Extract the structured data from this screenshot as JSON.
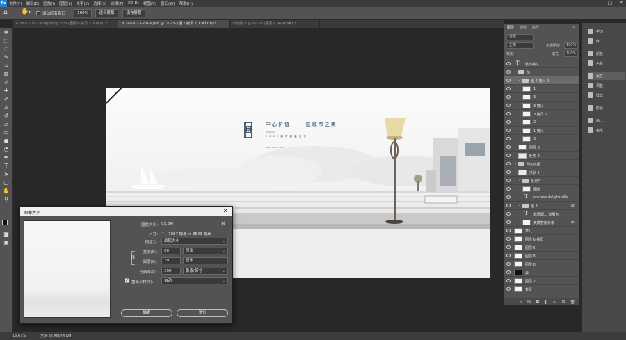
{
  "menubar": {
    "logo": "Ps",
    "items": [
      "文件(F)",
      "编辑(E)",
      "图像(I)",
      "图层(L)",
      "文字(Y)",
      "选择(S)",
      "滤镜(T)",
      "3D(D)",
      "视图(V)",
      "窗口(W)",
      "帮助(H)"
    ],
    "window_buttons": [
      "—",
      "□",
      "✕"
    ]
  },
  "options": {
    "scroll_all_label": "滚动所有窗口",
    "zoom_value": "100%",
    "fit_screen_label": "适合屏幕",
    "fill_screen_label": "填充屏幕"
  },
  "tabs": [
    {
      "label": "2018-12-25-1-h-w.psd @ 25% (图层 6 拷贝, CMYK/8) *",
      "active": false
    },
    {
      "label": "2020-07-27-2-h-w.psd @ 16.7% (组 2 拷贝 2, CMYK/8) *",
      "active": true
    },
    {
      "label": "未标题-1 @ 66.7% (图层 1, RGB/8#) *",
      "active": false
    }
  ],
  "canvas": {
    "headline": "中心价值 · 一揽城市之美",
    "subline": "2 0 1 9 城 市 新 量 力 作",
    "small_caption": "Since Mome Glas",
    "logo_char": "卧"
  },
  "right_strip": {
    "items": [
      "学习",
      "库",
      "颜色",
      "色板",
      "属性",
      "调整",
      "样式",
      "形状",
      "画...",
      "画笔"
    ]
  },
  "layers_panel": {
    "tabs": [
      "图层",
      "通道",
      "路径"
    ],
    "filter_label": "类型",
    "blend_mode": "正常",
    "opacity_label": "不透明度",
    "opacity_value": "100%",
    "lock_label": "锁定:",
    "fill_label": "填充",
    "fill_value": "100%",
    "layers": [
      {
        "name": "装饰英文",
        "kind": "text",
        "indent": 0
      },
      {
        "name": "前",
        "kind": "group",
        "indent": 0
      },
      {
        "name": "组 2 拷贝 2",
        "kind": "group",
        "indent": 1,
        "selected": true
      },
      {
        "name": "1",
        "kind": "pixel",
        "indent": 2
      },
      {
        "name": "3",
        "kind": "pixel",
        "indent": 2
      },
      {
        "name": "3 拷贝",
        "kind": "pixel",
        "indent": 2
      },
      {
        "name": "3 拷贝 2",
        "kind": "pixel",
        "indent": 2
      },
      {
        "name": "2",
        "kind": "pixel",
        "indent": 2
      },
      {
        "name": "1 拷贝",
        "kind": "pixel",
        "indent": 2
      },
      {
        "name": "3",
        "kind": "pixel",
        "indent": 2
      },
      {
        "name": "图层 6",
        "kind": "pixel",
        "indent": 1
      },
      {
        "name": "矩形 2",
        "kind": "shape",
        "indent": 1
      },
      {
        "name": "附加底图",
        "kind": "group",
        "indent": 0
      },
      {
        "name": "形状 2",
        "kind": "shape",
        "indent": 1
      },
      {
        "name": "系列环",
        "kind": "group",
        "indent": 1
      },
      {
        "name": "图鹏",
        "kind": "pixel",
        "indent": 2
      },
      {
        "name": "chinese delight villa",
        "kind": "text",
        "indent": 2
      },
      {
        "name": "组 3",
        "kind": "group",
        "indent": 1,
        "fx": "fx"
      },
      {
        "name": "数网配... 建服务",
        "kind": "text",
        "indent": 2
      },
      {
        "name": "关键智能对象",
        "kind": "pixel",
        "indent": 2,
        "fx": "fx"
      },
      {
        "name": "草几",
        "kind": "pixel",
        "indent": 0
      },
      {
        "name": "图层 6 拷贝",
        "kind": "pixel",
        "indent": 0
      },
      {
        "name": "图层 5",
        "kind": "pixel",
        "indent": 0
      },
      {
        "name": "图层 6",
        "kind": "pixel",
        "indent": 0
      },
      {
        "name": "图层 8",
        "kind": "pixel",
        "indent": 0
      },
      {
        "name": "云",
        "kind": "masked",
        "indent": 0
      },
      {
        "name": "图层 2",
        "kind": "pixel",
        "indent": 0
      },
      {
        "name": "背景",
        "kind": "pixel",
        "indent": 0
      }
    ],
    "footer_icons": [
      "link-icon",
      "fx-icon",
      "mask-icon",
      "adjustment-icon",
      "folder-icon",
      "new-layer-icon",
      "trash-icon"
    ]
  },
  "status": {
    "zoom": "16.67%",
    "doc_info": "文档:95.8M/68.6M"
  },
  "dialog": {
    "title": "图像大小",
    "size_label": "图像大小:",
    "size_value": "95.8M",
    "dims_label": "尺寸:",
    "dims_value": "7087 像素 × 3543 像素",
    "fit_label": "调整为:",
    "fit_value": "原稿大小",
    "width_label": "宽度(D):",
    "width_value": "60",
    "width_unit": "厘米",
    "height_label": "高度(G):",
    "height_value": "30",
    "height_unit": "厘米",
    "res_label": "分辨率(R):",
    "res_value": "300",
    "res_unit": "像素/英寸",
    "resample_label": "重新采样(S):",
    "resample_value": "自动",
    "resample_checked": true,
    "ok_label": "确定",
    "reset_label": "复位"
  }
}
